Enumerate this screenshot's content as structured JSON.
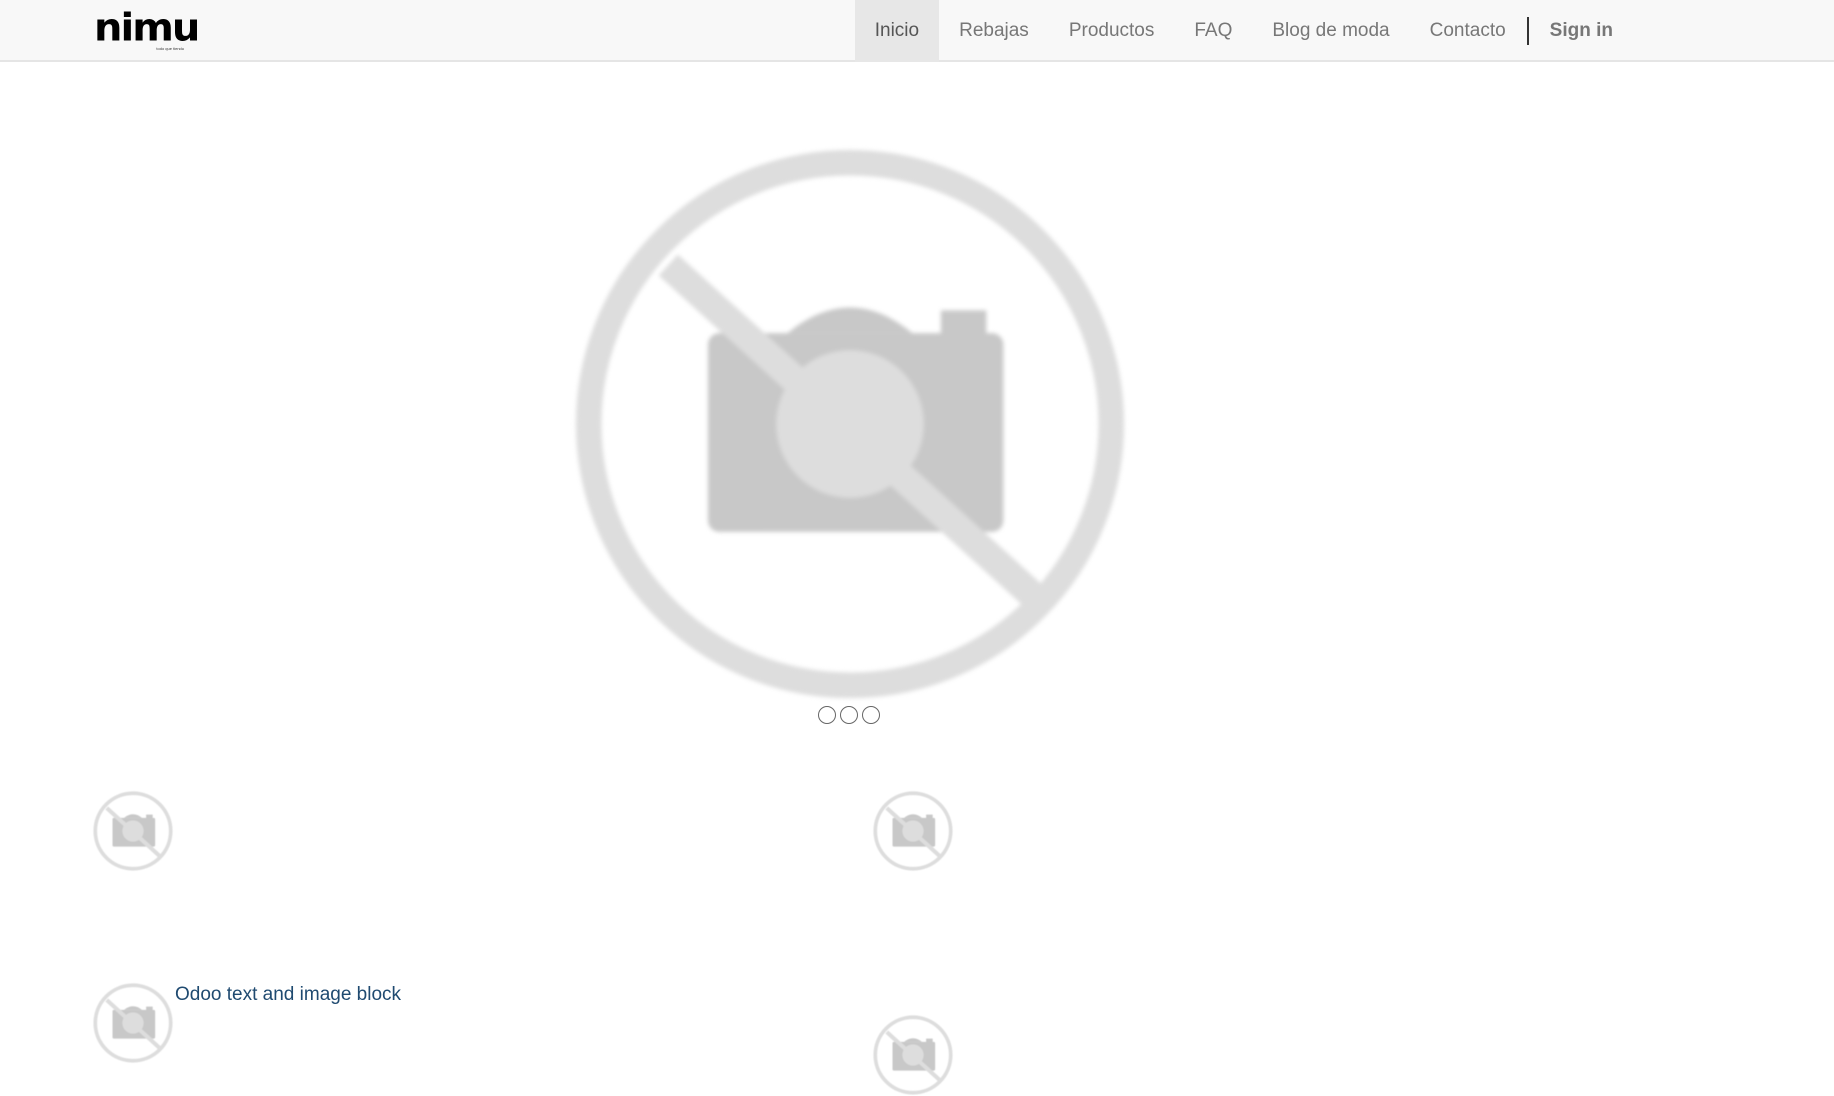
{
  "brand": {
    "name": "nimu",
    "tagline": "todo que tiendu"
  },
  "nav": {
    "items": [
      {
        "label": "Inicio",
        "active": true
      },
      {
        "label": "Rebajas",
        "active": false
      },
      {
        "label": "Productos",
        "active": false
      },
      {
        "label": "FAQ",
        "active": false
      },
      {
        "label": "Blog de moda",
        "active": false
      },
      {
        "label": "Contacto",
        "active": false
      }
    ],
    "sign_in": "Sign in"
  },
  "carousel": {
    "slide_icon": "no-image-camera-icon",
    "indicators": 3,
    "active_index": 0
  },
  "content": {
    "block_title": "Odoo text and image block",
    "thumbnail_icon": "no-image-camera-icon"
  },
  "colors": {
    "navbar_bg": "#f8f8f8",
    "active_tab_bg": "#e7e7e7",
    "nav_text": "#777777",
    "placeholder_gray": "#dddddd",
    "camera_gray": "#c8c8c8",
    "link_blue": "#1f4a70"
  }
}
